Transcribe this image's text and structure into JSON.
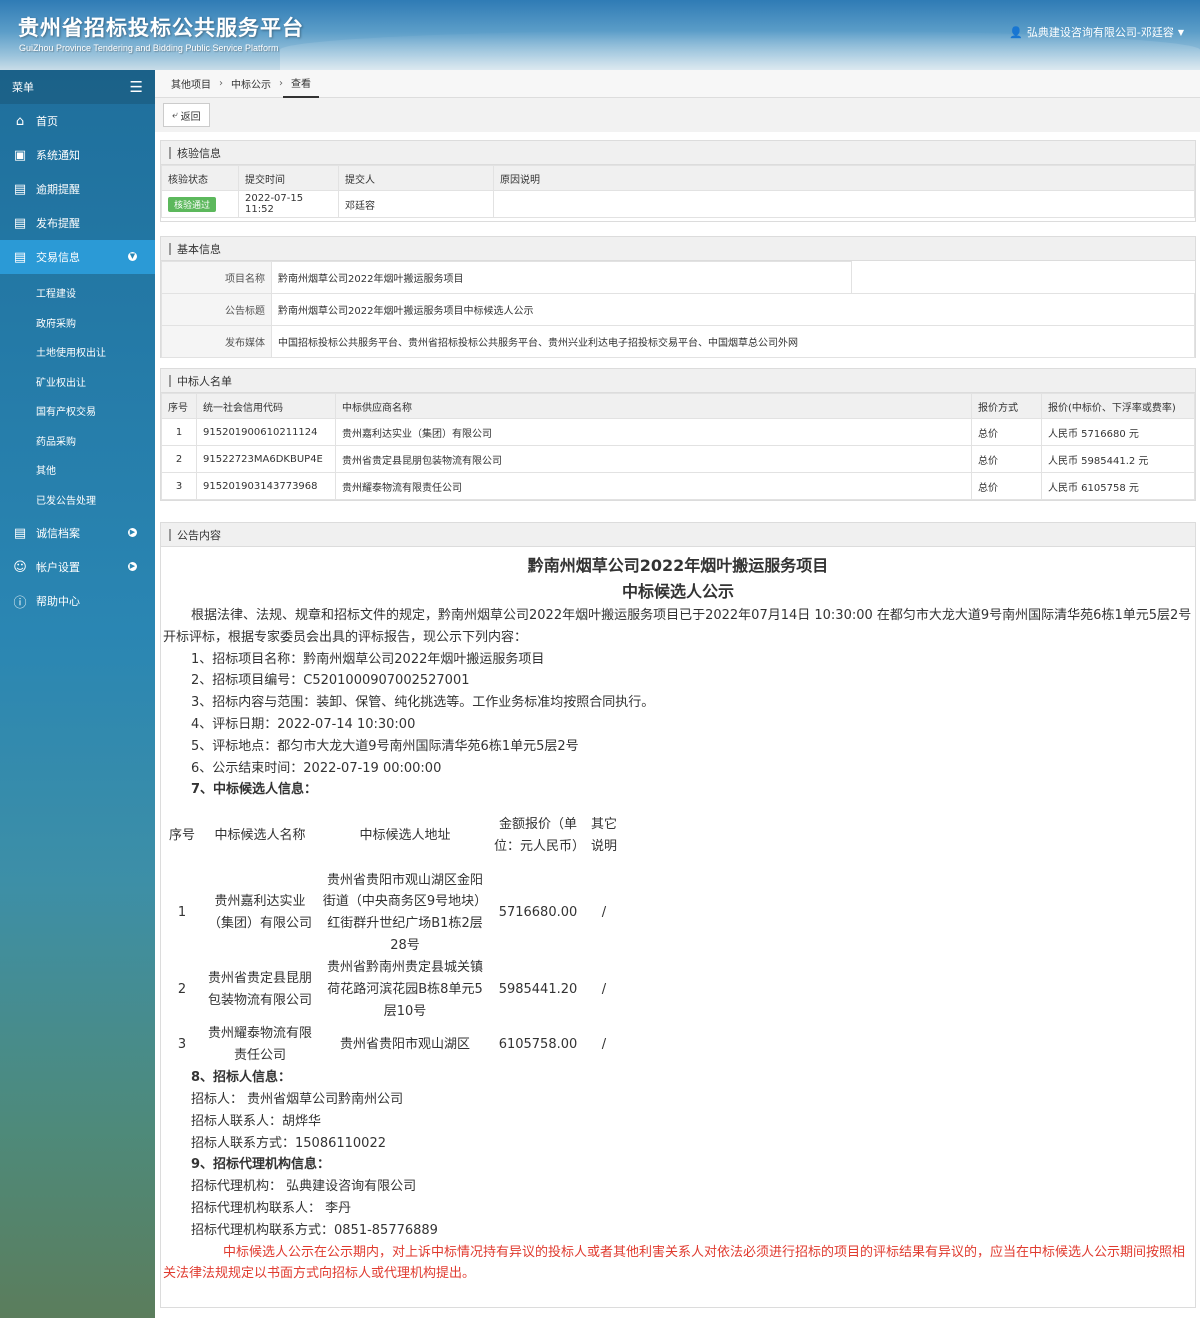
{
  "header": {
    "title": "贵州省招标投标公共服务平台",
    "subtitle": "GuiZhou Province Tendering and Bidding Public Service Platform",
    "user": "弘典建设咨询有限公司-邓廷容"
  },
  "sidebar": {
    "menu_label": "菜单",
    "items": [
      {
        "label": "首页",
        "icon": "home-icon"
      },
      {
        "label": "系统通知",
        "icon": "monitor-icon"
      },
      {
        "label": "逾期提醒",
        "icon": "list-icon"
      },
      {
        "label": "发布提醒",
        "icon": "list-icon"
      },
      {
        "label": "交易信息",
        "icon": "list-icon"
      }
    ],
    "sub_items": [
      "工程建设",
      "政府采购",
      "土地使用权出让",
      "矿业权出让",
      "国有产权交易",
      "药品采购",
      "其他",
      "已发公告处理"
    ],
    "bottom_items": [
      {
        "label": "诚信档案",
        "icon": "list-icon"
      },
      {
        "label": "帐户设置",
        "icon": "user-icon"
      },
      {
        "label": "帮助中心",
        "icon": "help-icon"
      }
    ]
  },
  "breadcrumb": [
    "其他项目",
    "中标公示",
    "查看"
  ],
  "toolbar": {
    "back_label": "返回"
  },
  "verify": {
    "title": "核验信息",
    "headers": [
      "核验状态",
      "提交时间",
      "提交人",
      "原因说明"
    ],
    "row": {
      "status": "核验通过",
      "time": "2022-07-15 11:52",
      "submitter": "邓廷容",
      "reason": ""
    }
  },
  "basic": {
    "title": "基本信息",
    "rows": [
      {
        "label": "项目名称",
        "value": "黔南州烟草公司2022年烟叶搬运服务项目"
      },
      {
        "label": "公告标题",
        "value": "黔南州烟草公司2022年烟叶搬运服务项目中标候选人公示"
      },
      {
        "label": "发布媒体",
        "value": "中国招标投标公共服务平台、贵州省招标投标公共服务平台、贵州兴业利达电子招投标交易平台、中国烟草总公司外网"
      }
    ]
  },
  "winners": {
    "title": "中标人名单",
    "headers": [
      "序号",
      "统一社会信用代码",
      "中标供应商名称",
      "报价方式",
      "报价(中标价、下浮率或费率)"
    ],
    "rows": [
      {
        "no": "1",
        "code": "915201900610211124",
        "name": "贵州嘉利达实业（集团）有限公司",
        "method": "总价",
        "price": "人民币 5716680 元"
      },
      {
        "no": "2",
        "code": "91522723MA6DKBUP4E",
        "name": "贵州省贵定县昆朋包装物流有限公司",
        "method": "总价",
        "price": "人民币 5985441.2 元"
      },
      {
        "no": "3",
        "code": "915201903143773968",
        "name": "贵州耀泰物流有限责任公司",
        "method": "总价",
        "price": "人民币 6105758 元"
      }
    ]
  },
  "announcement": {
    "title": "公告内容",
    "heading1": "黔南州烟草公司2022年烟叶搬运服务项目",
    "heading2": "中标候选人公示",
    "intro": "根据法律、法规、规章和招标文件的规定，黔南州烟草公司2022年烟叶搬运服务项目已于2022年07月14日 10:30:00 在都匀市大龙大道9号南州国际清华苑6栋1单元5层2号开标评标，根据专家委员会出具的评标报告，现公示下列内容：",
    "items": [
      "1、招标项目名称：黔南州烟草公司2022年烟叶搬运服务项目",
      "2、招标项目编号：C5201000907002527001",
      "3、招标内容与范围：装卸、保管、纯化挑选等。工作业务标准均按照合同执行。",
      "4、评标日期：2022-07-14 10:30:00",
      "5、评标地点：都匀市大龙大道9号南州国际清华苑6栋1单元5层2号",
      "6、公示结束时间：2022-07-19  00:00:00"
    ],
    "section7": "7、中标候选人信息：",
    "cand_headers": [
      "序号",
      "中标候选人名称",
      "中标候选人地址",
      "金额报价（单位：元人民币）",
      "其它说明"
    ],
    "cand_rows": [
      {
        "no": "1",
        "name": "贵州嘉利达实业（集团）有限公司",
        "addr": "贵州省贵阳市观山湖区金阳街道（中央商务区9号地块）红街群升世纪广场B1栋2层28号",
        "amount": "5716680.00",
        "note": "/"
      },
      {
        "no": "2",
        "name": "贵州省贵定县昆朋包装物流有限公司",
        "addr": "贵州省黔南州贵定县城关镇荷花路河滨花园B栋8单元5层10号",
        "amount": "5985441.20",
        "note": "/"
      },
      {
        "no": "3",
        "name": "贵州耀泰物流有限责任公司",
        "addr": "贵州省贵阳市观山湖区",
        "amount": "6105758.00",
        "note": "/"
      }
    ],
    "section8": "8、招标人信息：",
    "tenderer": "招标人：  贵州省烟草公司黔南州公司",
    "tenderer_contact": "招标人联系人：胡烨华",
    "tenderer_phone": "招标人联系方式：15086110022",
    "section9": "9、招标代理机构信息：",
    "agency": "招标代理机构：  弘典建设咨询有限公司",
    "agency_contact": "招标代理机构联系人：  李丹",
    "agency_phone": "招标代理机构联系方式：0851-85776889",
    "notice": "中标候选人公示在公示期内，对上诉中标情况持有异议的投标人或者其他利害关系人对依法必须进行招标的项目的评标结果有异议的，应当在中标候选人公示期间按照相关法律法规规定以书面方式向招标人或代理机构提出。"
  }
}
